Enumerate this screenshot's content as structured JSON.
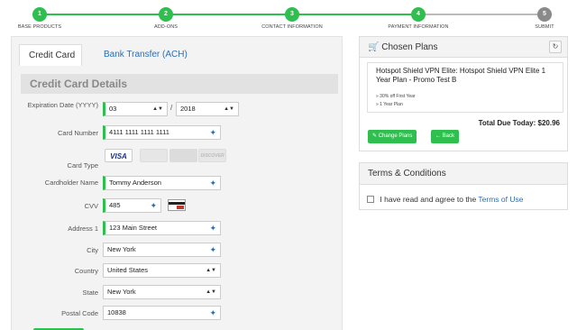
{
  "steps": [
    {
      "number": "1",
      "label": "Base Products",
      "state": "done"
    },
    {
      "number": "2",
      "label": "Add-ons",
      "state": "done"
    },
    {
      "number": "3",
      "label": "Contact Information",
      "state": "done"
    },
    {
      "number": "4",
      "label": "Payment Information",
      "state": "done"
    },
    {
      "number": "5",
      "label": "Submit",
      "state": "todo"
    }
  ],
  "colors": {
    "accent_green": "#2fbf4f",
    "link_blue": "#2a6fb5",
    "inactive_step": "#8a8a8a"
  },
  "tabs": {
    "credit_card": "Credit Card",
    "bank_transfer": "Bank Transfer (ACH)"
  },
  "form": {
    "section_title": "Credit Card Details",
    "expiration": {
      "label": "Expiration Date (YYYY)",
      "month": "03",
      "separator": "/",
      "year": "2018"
    },
    "card_number": {
      "label": "Card Number",
      "value": "4111 1111 1111 1111"
    },
    "card_type": {
      "label": "Card Type",
      "logos": [
        "VISA",
        "MasterCard",
        "AMEX",
        "DISCOVER"
      ]
    },
    "cardholder": {
      "label": "Cardholder Name",
      "value": "Tommy Anderson"
    },
    "cvv": {
      "label": "CVV",
      "value": "485"
    },
    "address1": {
      "label": "Address 1",
      "value": "123 Main Street"
    },
    "city": {
      "label": "City",
      "value": "New York"
    },
    "country": {
      "label": "Country",
      "value": "United States"
    },
    "state": {
      "label": "State",
      "value": "New York"
    },
    "postal": {
      "label": "Postal Code",
      "value": "10838"
    }
  },
  "chosen_plans": {
    "title": "Chosen Plans",
    "plan_name": "Hotspot Shield VPN Elite: Hotspot Shield VPN Elite 1 Year Plan - Promo Test B",
    "features": [
      "» 30% off First Year",
      "» 1 Year Plan"
    ],
    "total_label": "Total Due Today:",
    "total_value": "$20.96",
    "change_button": "Change Plans",
    "back_button": "Back"
  },
  "terms": {
    "title": "Terms & Conditions",
    "text": "I have read and agree to the",
    "link": "Terms of Use"
  }
}
